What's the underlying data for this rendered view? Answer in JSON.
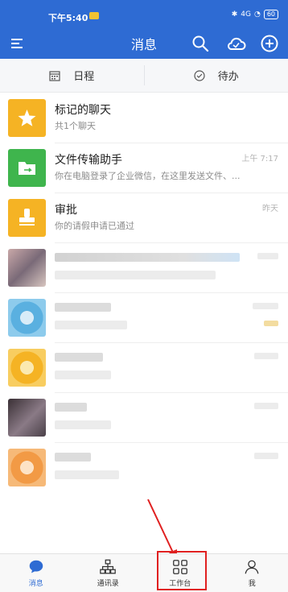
{
  "status_bar": {
    "time": "下午5:40",
    "signal": "4G",
    "battery": "60"
  },
  "header": {
    "title": "消息"
  },
  "subbar": {
    "schedule_label": "日程",
    "todo_label": "待办"
  },
  "conversations": [
    {
      "name": "标记的聊天",
      "preview": "共1个聊天",
      "time": "",
      "color": "#f5b324"
    },
    {
      "name": "文件传输助手",
      "preview": "你在电脑登录了企业微信，在这里发送文件、...",
      "time": "上午 7:17",
      "color": "#3fb54d"
    },
    {
      "name": "审批",
      "preview": "你的请假申请已通过",
      "time": "昨天",
      "color": "#f5b324"
    }
  ],
  "bottom_nav": [
    {
      "label": "消息",
      "active": true
    },
    {
      "label": "通讯录",
      "active": false
    },
    {
      "label": "工作台",
      "active": false
    },
    {
      "label": "我",
      "active": false
    }
  ],
  "colors": {
    "brand": "#2e6bd3",
    "highlight": "#e02020"
  }
}
